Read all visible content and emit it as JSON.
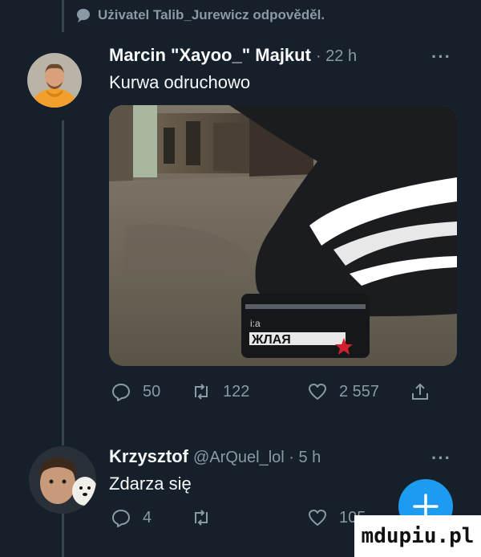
{
  "reply_context": {
    "icon": "speech-bubble-icon",
    "text": "Użivatel Talib_Jurewicz odpověděl."
  },
  "tweets": [
    {
      "author_name": "Marcin \"Xayoo_\" Majkut",
      "time": "· 22 h",
      "more": "···",
      "text": "Kurwa odruchowo",
      "media": {
        "can_label_top": "i:a",
        "can_label_main": "ЖЛAЯ"
      },
      "stats": {
        "replies": "50",
        "retweets": "122",
        "likes": "2 557"
      }
    },
    {
      "author_name": "Krzysztof",
      "handle_time": "@ArQuel_lol · 5 h",
      "more": "···",
      "text": "Zdarza się",
      "stats": {
        "replies": "4",
        "retweets": "",
        "likes": "105"
      }
    }
  ],
  "fab": {
    "icon": "plus-icon",
    "color": "#1d9bf0"
  },
  "watermark": "mdupiu.pl",
  "colors": {
    "background": "#15202b",
    "secondary_text": "#8b98a5",
    "accent": "#1d9bf0"
  }
}
